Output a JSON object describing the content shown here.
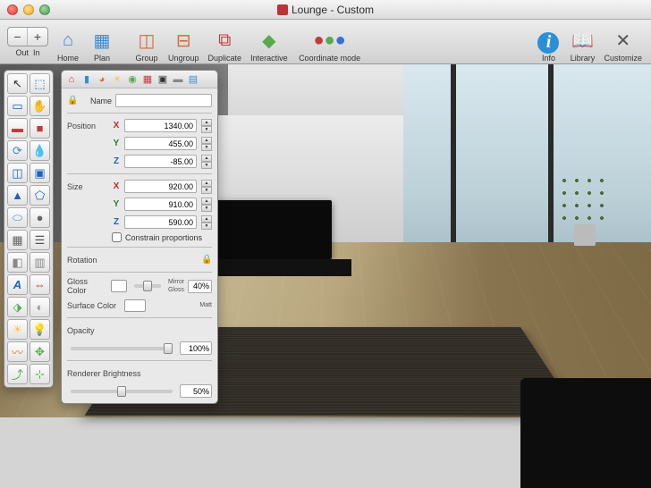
{
  "window": {
    "title": "Lounge - Custom"
  },
  "toolbar": {
    "out": "Out",
    "in": "In",
    "home": "Home",
    "plan": "Plan",
    "group": "Group",
    "ungroup": "Ungroup",
    "duplicate": "Duplicate",
    "interactive": "Interactive",
    "coordinate": "Coordinate mode",
    "info": "Info",
    "library": "Library",
    "customize": "Customize"
  },
  "inspector": {
    "name_label": "Name",
    "name_value": "",
    "position_label": "Position",
    "pos": {
      "x": "1340.00",
      "y": "455.00",
      "z": "-85.00"
    },
    "size_label": "Size",
    "size": {
      "x": "920.00",
      "y": "910.00",
      "z": "590.00"
    },
    "constrain_label": "Constrain proportions",
    "rotation_label": "Rotation",
    "gloss_label": "Gloss Color",
    "surface_label": "Surface Color",
    "mirror_label": "Mirror",
    "gloss_sublabel": "Gloss",
    "matt_label": "Matt",
    "gloss_pct": "40%",
    "opacity_label": "Opacity",
    "opacity_pct": "100%",
    "brightness_label": "Renderer Brightness",
    "brightness_pct": "50%"
  },
  "axes": {
    "x": "X",
    "y": "Y",
    "z": "Z"
  }
}
